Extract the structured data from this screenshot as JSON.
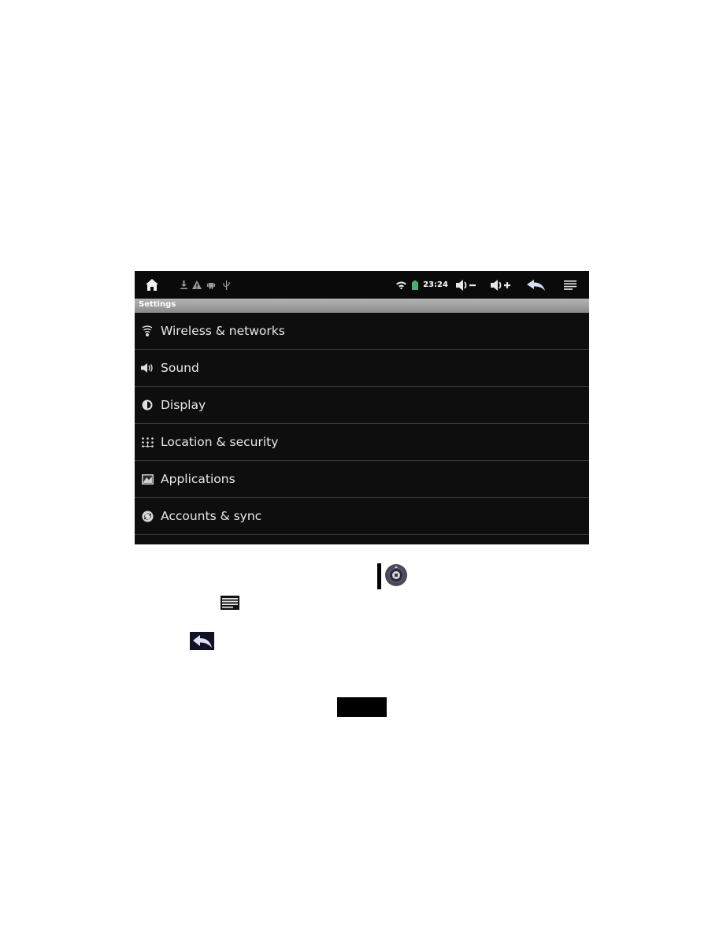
{
  "statusbar": {
    "home_icon": "home-icon",
    "notification_icons": [
      "download-icon",
      "warning-icon",
      "android-debug-icon",
      "usb-icon"
    ],
    "wifi_icon": "wifi-icon",
    "battery_icon": "battery-icon",
    "time": "23:24",
    "volume_down_icon": "volume-down-icon",
    "volume_up_icon": "volume-up-icon",
    "back_icon": "back-icon",
    "menu_icon": "menu-icon",
    "accent_color": "#4caf72"
  },
  "title": "Settings",
  "settings_items": [
    {
      "label": "Wireless & networks",
      "icon": "wifi-icon"
    },
    {
      "label": "Sound",
      "icon": "speaker-icon"
    },
    {
      "label": "Display",
      "icon": "brightness-icon"
    },
    {
      "label": "Location & security",
      "icon": "location-grid-icon"
    },
    {
      "label": "Applications",
      "icon": "applications-icon"
    },
    {
      "label": "Accounts & sync",
      "icon": "sync-icon"
    }
  ],
  "document_icons": [
    "dpad-icon",
    "menu-icon",
    "back-icon"
  ]
}
